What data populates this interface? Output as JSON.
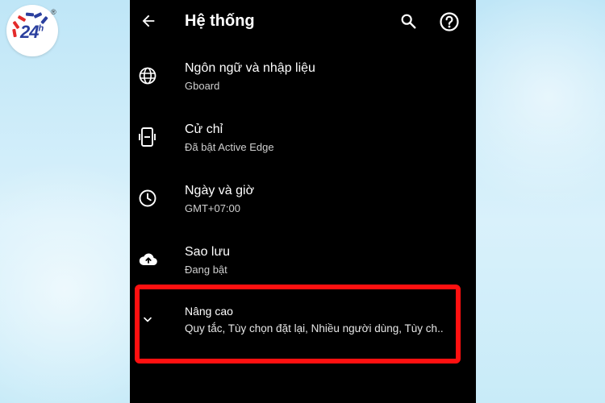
{
  "logo": {
    "text": "24",
    "sup": "h",
    "reg": "®"
  },
  "header": {
    "title": "Hệ thống"
  },
  "items": [
    {
      "title": "Ngôn ngữ và nhập liệu",
      "subtitle": "Gboard",
      "icon": "globe-icon"
    },
    {
      "title": "Cử chỉ",
      "subtitle": "Đã bật Active Edge",
      "icon": "phone-gesture-icon"
    },
    {
      "title": "Ngày và giờ",
      "subtitle": "GMT+07:00",
      "icon": "clock-icon"
    },
    {
      "title": "Sao lưu",
      "subtitle": "Đang bật",
      "icon": "cloud-upload-icon"
    },
    {
      "title": "Nâng cao",
      "subtitle": "Quy tắc, Tùy chọn đặt lại, Nhiều người dùng, Tùy ch..",
      "icon": "chevron-down-icon"
    }
  ],
  "colors": {
    "highlight": "#ff1010",
    "screen_bg": "#000000",
    "brand": "#2a3f9e"
  }
}
